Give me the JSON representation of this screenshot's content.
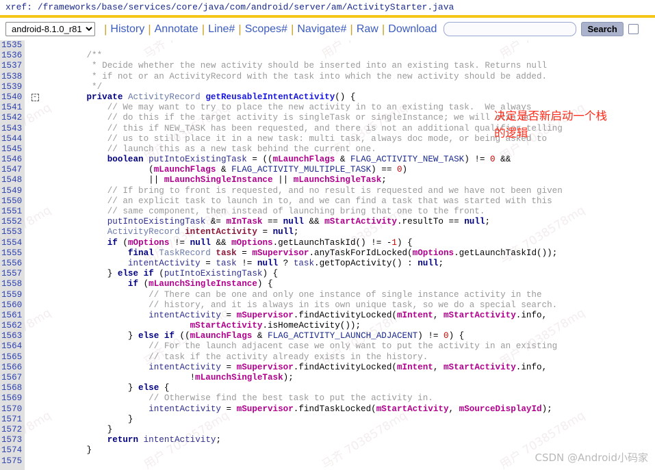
{
  "xref": {
    "label": "xref:",
    "path": "/frameworks/base/services/core/java/com/android/server/am/ActivityStarter.java"
  },
  "toolbar": {
    "version_selected": "android-8.1.0_r81",
    "version_options": [
      "android-8.1.0_r81"
    ],
    "links": [
      "History",
      "Annotate",
      "Line#",
      "Scopes#",
      "Navigate#",
      "Raw",
      "Download"
    ],
    "separator": "|",
    "search_value": "",
    "search_placeholder": "",
    "search_button_label": "Search",
    "checkbox_checked": false
  },
  "annotation": {
    "line1": "决定是否新启动一个栈",
    "line2": "的逻辑",
    "color": "#ff2a18"
  },
  "watermark": {
    "csdn": "CSDN @Android小码家",
    "tiles": [
      "用户 7038578mq",
      "马齐 7038578mq",
      "用户 7038578mq"
    ]
  },
  "colors": {
    "gold_rule": "#f5c518",
    "gutter": "#e0e0e0",
    "line_number": "#2a3fae",
    "keyword": "#000080",
    "method": "#1717e0",
    "member": "#b0008c",
    "local_var": "#8b1a3a",
    "comment": "#9a9a9a",
    "number": "#cc0000",
    "link": "#3b5bbf"
  },
  "code": {
    "first_line": 1535,
    "last_line": 1575,
    "fold_marker_line": 1540,
    "lines": [
      {
        "n": 1535,
        "tokens": []
      },
      {
        "n": 1536,
        "tokens": [
          {
            "t": "        ",
            "c": "op"
          },
          {
            "t": "/**",
            "c": "cmt"
          }
        ]
      },
      {
        "n": 1537,
        "tokens": [
          {
            "t": "         ",
            "c": "op"
          },
          {
            "t": "* Decide whether the new activity should be inserted into an existing task. Returns null",
            "c": "cmt"
          }
        ]
      },
      {
        "n": 1538,
        "tokens": [
          {
            "t": "         ",
            "c": "op"
          },
          {
            "t": "* if not or an ActivityRecord with the task into which the new activity should be added.",
            "c": "cmt"
          }
        ]
      },
      {
        "n": 1539,
        "tokens": [
          {
            "t": "         ",
            "c": "op"
          },
          {
            "t": "*/",
            "c": "cmt"
          }
        ]
      },
      {
        "n": 1540,
        "fold": true,
        "tokens": [
          {
            "t": "        ",
            "c": "op"
          },
          {
            "t": "private",
            "c": "kw"
          },
          {
            "t": " ",
            "c": "op"
          },
          {
            "t": "ActivityRecord",
            "c": "type"
          },
          {
            "t": " ",
            "c": "op"
          },
          {
            "t": "getReusableIntentActivity",
            "c": "mname"
          },
          {
            "t": "() {",
            "c": "punc"
          }
        ]
      },
      {
        "n": 1541,
        "tokens": [
          {
            "t": "            ",
            "c": "op"
          },
          {
            "t": "// We may want to try to place the new activity in to an existing task.  We always",
            "c": "cmt"
          }
        ]
      },
      {
        "n": 1542,
        "tokens": [
          {
            "t": "            ",
            "c": "op"
          },
          {
            "t": "// do this if the target activity is singleTask or singleInstance; we will also do",
            "c": "cmt"
          }
        ]
      },
      {
        "n": 1543,
        "tokens": [
          {
            "t": "            ",
            "c": "op"
          },
          {
            "t": "// this if NEW_TASK has been requested, and there is not an additional qualifier telling",
            "c": "cmt"
          }
        ]
      },
      {
        "n": 1544,
        "tokens": [
          {
            "t": "            ",
            "c": "op"
          },
          {
            "t": "// us to still place it in a new task: multi task, always doc mode, or being asked to",
            "c": "cmt"
          }
        ]
      },
      {
        "n": 1545,
        "tokens": [
          {
            "t": "            ",
            "c": "op"
          },
          {
            "t": "// launch this as a new task behind the current one.",
            "c": "cmt"
          }
        ]
      },
      {
        "n": 1546,
        "tokens": [
          {
            "t": "            ",
            "c": "op"
          },
          {
            "t": "boolean",
            "c": "kw"
          },
          {
            "t": " ",
            "c": "op"
          },
          {
            "t": "putIntoExistingTask",
            "c": "plain"
          },
          {
            "t": " = ((",
            "c": "punc"
          },
          {
            "t": "mLaunchFlags",
            "c": "mem"
          },
          {
            "t": " & ",
            "c": "punc"
          },
          {
            "t": "FLAG_ACTIVITY_NEW_TASK",
            "c": "const"
          },
          {
            "t": ") != ",
            "c": "punc"
          },
          {
            "t": "0",
            "c": "num"
          },
          {
            "t": " &&",
            "c": "punc"
          }
        ]
      },
      {
        "n": 1547,
        "tokens": [
          {
            "t": "                    (",
            "c": "punc"
          },
          {
            "t": "mLaunchFlags",
            "c": "mem"
          },
          {
            "t": " & ",
            "c": "punc"
          },
          {
            "t": "FLAG_ACTIVITY_MULTIPLE_TASK",
            "c": "const"
          },
          {
            "t": ") == ",
            "c": "punc"
          },
          {
            "t": "0",
            "c": "num"
          },
          {
            "t": ")",
            "c": "punc"
          }
        ]
      },
      {
        "n": 1548,
        "tokens": [
          {
            "t": "                    || ",
            "c": "punc"
          },
          {
            "t": "mLaunchSingleInstance",
            "c": "mem"
          },
          {
            "t": " || ",
            "c": "punc"
          },
          {
            "t": "mLaunchSingleTask",
            "c": "mem"
          },
          {
            "t": ";",
            "c": "punc"
          }
        ]
      },
      {
        "n": 1549,
        "tokens": [
          {
            "t": "            ",
            "c": "op"
          },
          {
            "t": "// If bring to front is requested, and no result is requested and we have not been given",
            "c": "cmt"
          }
        ]
      },
      {
        "n": 1550,
        "tokens": [
          {
            "t": "            ",
            "c": "op"
          },
          {
            "t": "// an explicit task to launch in to, and we can find a task that was started with this",
            "c": "cmt"
          }
        ]
      },
      {
        "n": 1551,
        "tokens": [
          {
            "t": "            ",
            "c": "op"
          },
          {
            "t": "// same component, then instead of launching bring that one to the front.",
            "c": "cmt"
          }
        ]
      },
      {
        "n": 1552,
        "tokens": [
          {
            "t": "            ",
            "c": "op"
          },
          {
            "t": "putIntoExistingTask",
            "c": "plain"
          },
          {
            "t": " &= ",
            "c": "punc"
          },
          {
            "t": "mInTask",
            "c": "mem"
          },
          {
            "t": " == ",
            "c": "punc"
          },
          {
            "t": "null",
            "c": "kw"
          },
          {
            "t": " && ",
            "c": "punc"
          },
          {
            "t": "mStartActivity",
            "c": "mem"
          },
          {
            "t": ".resultTo == ",
            "c": "punc"
          },
          {
            "t": "null",
            "c": "kw"
          },
          {
            "t": ";",
            "c": "punc"
          }
        ]
      },
      {
        "n": 1553,
        "tokens": [
          {
            "t": "            ",
            "c": "op"
          },
          {
            "t": "ActivityRecord",
            "c": "type"
          },
          {
            "t": " ",
            "c": "op"
          },
          {
            "t": "intentActivity",
            "c": "lvar"
          },
          {
            "t": " = ",
            "c": "punc"
          },
          {
            "t": "null",
            "c": "kw"
          },
          {
            "t": ";",
            "c": "punc"
          }
        ]
      },
      {
        "n": 1554,
        "tokens": [
          {
            "t": "            ",
            "c": "op"
          },
          {
            "t": "if",
            "c": "kw"
          },
          {
            "t": " (",
            "c": "punc"
          },
          {
            "t": "mOptions",
            "c": "mem"
          },
          {
            "t": " != ",
            "c": "punc"
          },
          {
            "t": "null",
            "c": "kw"
          },
          {
            "t": " && ",
            "c": "punc"
          },
          {
            "t": "mOptions",
            "c": "mem"
          },
          {
            "t": ".getLaunchTaskId() != -",
            "c": "punc"
          },
          {
            "t": "1",
            "c": "num"
          },
          {
            "t": ") {",
            "c": "punc"
          }
        ]
      },
      {
        "n": 1555,
        "tokens": [
          {
            "t": "                ",
            "c": "op"
          },
          {
            "t": "final",
            "c": "kw"
          },
          {
            "t": " ",
            "c": "op"
          },
          {
            "t": "TaskRecord",
            "c": "type"
          },
          {
            "t": " ",
            "c": "op"
          },
          {
            "t": "task",
            "c": "lvar"
          },
          {
            "t": " = ",
            "c": "punc"
          },
          {
            "t": "mSupervisor",
            "c": "mem"
          },
          {
            "t": ".anyTaskForIdLocked(",
            "c": "punc"
          },
          {
            "t": "mOptions",
            "c": "mem"
          },
          {
            "t": ".getLaunchTaskId());",
            "c": "punc"
          }
        ]
      },
      {
        "n": 1556,
        "tokens": [
          {
            "t": "                ",
            "c": "op"
          },
          {
            "t": "intentActivity",
            "c": "plain"
          },
          {
            "t": " = ",
            "c": "punc"
          },
          {
            "t": "task",
            "c": "plain"
          },
          {
            "t": " != ",
            "c": "punc"
          },
          {
            "t": "null",
            "c": "kw"
          },
          {
            "t": " ? ",
            "c": "punc"
          },
          {
            "t": "task",
            "c": "plain"
          },
          {
            "t": ".getTopActivity() : ",
            "c": "punc"
          },
          {
            "t": "null",
            "c": "kw"
          },
          {
            "t": ";",
            "c": "punc"
          }
        ]
      },
      {
        "n": 1557,
        "tokens": [
          {
            "t": "            } ",
            "c": "punc"
          },
          {
            "t": "else if",
            "c": "kw"
          },
          {
            "t": " (",
            "c": "punc"
          },
          {
            "t": "putIntoExistingTask",
            "c": "plain"
          },
          {
            "t": ") {",
            "c": "punc"
          }
        ]
      },
      {
        "n": 1558,
        "tokens": [
          {
            "t": "                ",
            "c": "op"
          },
          {
            "t": "if",
            "c": "kw"
          },
          {
            "t": " (",
            "c": "punc"
          },
          {
            "t": "mLaunchSingleInstance",
            "c": "mem"
          },
          {
            "t": ") {",
            "c": "punc"
          }
        ]
      },
      {
        "n": 1559,
        "tokens": [
          {
            "t": "                    ",
            "c": "op"
          },
          {
            "t": "// There can be one and only one instance of single instance activity in the",
            "c": "cmt"
          }
        ]
      },
      {
        "n": 1560,
        "tokens": [
          {
            "t": "                    ",
            "c": "op"
          },
          {
            "t": "// history, and it is always in its own unique task, so we do a special search.",
            "c": "cmt"
          }
        ]
      },
      {
        "n": 1561,
        "tokens": [
          {
            "t": "                    ",
            "c": "op"
          },
          {
            "t": "intentActivity",
            "c": "plain"
          },
          {
            "t": " = ",
            "c": "punc"
          },
          {
            "t": "mSupervisor",
            "c": "mem"
          },
          {
            "t": ".findActivityLocked(",
            "c": "punc"
          },
          {
            "t": "mIntent",
            "c": "mem"
          },
          {
            "t": ", ",
            "c": "punc"
          },
          {
            "t": "mStartActivity",
            "c": "mem"
          },
          {
            "t": ".info,",
            "c": "punc"
          }
        ]
      },
      {
        "n": 1562,
        "tokens": [
          {
            "t": "                            ",
            "c": "op"
          },
          {
            "t": "mStartActivity",
            "c": "mem"
          },
          {
            "t": ".isHomeActivity());",
            "c": "punc"
          }
        ]
      },
      {
        "n": 1563,
        "tokens": [
          {
            "t": "                } ",
            "c": "punc"
          },
          {
            "t": "else if",
            "c": "kw"
          },
          {
            "t": " ((",
            "c": "punc"
          },
          {
            "t": "mLaunchFlags",
            "c": "mem"
          },
          {
            "t": " & ",
            "c": "punc"
          },
          {
            "t": "FLAG_ACTIVITY_LAUNCH_ADJACENT",
            "c": "const"
          },
          {
            "t": ") != ",
            "c": "punc"
          },
          {
            "t": "0",
            "c": "num"
          },
          {
            "t": ") {",
            "c": "punc"
          }
        ]
      },
      {
        "n": 1564,
        "tokens": [
          {
            "t": "                    ",
            "c": "op"
          },
          {
            "t": "// For the launch adjacent case we only want to put the activity in an existing",
            "c": "cmt"
          }
        ]
      },
      {
        "n": 1565,
        "tokens": [
          {
            "t": "                    ",
            "c": "op"
          },
          {
            "t": "// task if the activity already exists in the history.",
            "c": "cmt"
          }
        ]
      },
      {
        "n": 1566,
        "tokens": [
          {
            "t": "                    ",
            "c": "op"
          },
          {
            "t": "intentActivity",
            "c": "plain"
          },
          {
            "t": " = ",
            "c": "punc"
          },
          {
            "t": "mSupervisor",
            "c": "mem"
          },
          {
            "t": ".findActivityLocked(",
            "c": "punc"
          },
          {
            "t": "mIntent",
            "c": "mem"
          },
          {
            "t": ", ",
            "c": "punc"
          },
          {
            "t": "mStartActivity",
            "c": "mem"
          },
          {
            "t": ".info,",
            "c": "punc"
          }
        ]
      },
      {
        "n": 1567,
        "tokens": [
          {
            "t": "                            !",
            "c": "punc"
          },
          {
            "t": "mLaunchSingleTask",
            "c": "mem"
          },
          {
            "t": ");",
            "c": "punc"
          }
        ]
      },
      {
        "n": 1568,
        "tokens": [
          {
            "t": "                } ",
            "c": "punc"
          },
          {
            "t": "else",
            "c": "kw"
          },
          {
            "t": " {",
            "c": "punc"
          }
        ]
      },
      {
        "n": 1569,
        "tokens": [
          {
            "t": "                    ",
            "c": "op"
          },
          {
            "t": "// Otherwise find the best task to put the activity in.",
            "c": "cmt"
          }
        ]
      },
      {
        "n": 1570,
        "tokens": [
          {
            "t": "                    ",
            "c": "op"
          },
          {
            "t": "intentActivity",
            "c": "plain"
          },
          {
            "t": " = ",
            "c": "punc"
          },
          {
            "t": "mSupervisor",
            "c": "mem"
          },
          {
            "t": ".findTaskLocked(",
            "c": "punc"
          },
          {
            "t": "mStartActivity",
            "c": "mem"
          },
          {
            "t": ", ",
            "c": "punc"
          },
          {
            "t": "mSourceDisplayId",
            "c": "mem"
          },
          {
            "t": ");",
            "c": "punc"
          }
        ]
      },
      {
        "n": 1571,
        "tokens": [
          {
            "t": "                }",
            "c": "punc"
          }
        ]
      },
      {
        "n": 1572,
        "tokens": [
          {
            "t": "            }",
            "c": "punc"
          }
        ]
      },
      {
        "n": 1573,
        "tokens": [
          {
            "t": "            ",
            "c": "op"
          },
          {
            "t": "return",
            "c": "kw"
          },
          {
            "t": " ",
            "c": "op"
          },
          {
            "t": "intentActivity",
            "c": "plain"
          },
          {
            "t": ";",
            "c": "punc"
          }
        ]
      },
      {
        "n": 1574,
        "tokens": [
          {
            "t": "        }",
            "c": "punc"
          }
        ]
      },
      {
        "n": 1575,
        "tokens": []
      }
    ]
  }
}
